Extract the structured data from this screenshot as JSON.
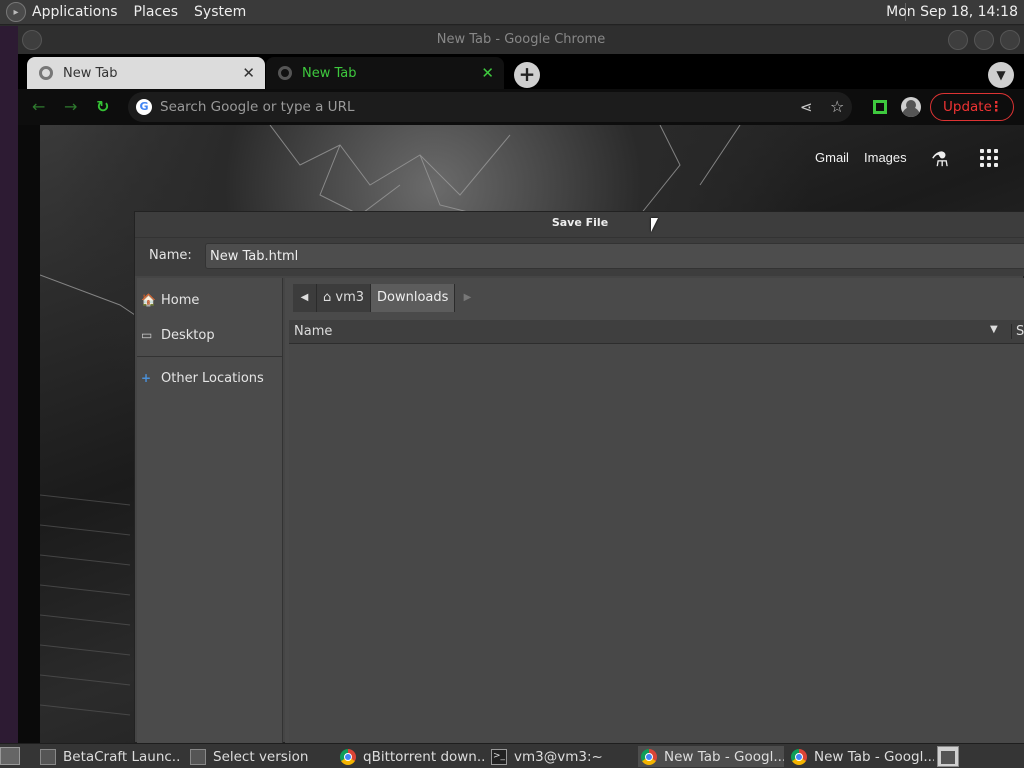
{
  "top_panel": {
    "menus": [
      "Applications",
      "Places",
      "System"
    ],
    "clock": "Mon Sep 18, 14:18"
  },
  "chrome": {
    "window_title": "New Tab - Google Chrome",
    "tabs": [
      {
        "label": "New Tab",
        "close": "✕"
      },
      {
        "label": "New Tab",
        "close": "✕"
      }
    ],
    "new_tab": "+",
    "omnibox_placeholder": "Search Google or type a URL",
    "update_label": "Update",
    "ntp_links": {
      "gmail": "Gmail",
      "images": "Images"
    }
  },
  "dialog": {
    "title": "Save File",
    "name_label": "Name:",
    "filename": "New Tab.html",
    "places": [
      {
        "label": "Home",
        "icon": "home-folder-icon"
      },
      {
        "label": "Desktop",
        "icon": "desktop-folder-icon"
      },
      {
        "label": "Other Locations",
        "icon": "plus-icon"
      }
    ],
    "path": [
      "vm3",
      "Downloads"
    ],
    "columns": {
      "name": "Name",
      "size": "Si"
    }
  },
  "taskbar": {
    "items": [
      {
        "label": "BetaCraft Launc...",
        "icon": "java-icon"
      },
      {
        "label": "Select version",
        "icon": "java-icon"
      },
      {
        "label": "qBittorrent down...",
        "icon": "chrome-icon"
      },
      {
        "label": "vm3@vm3:~",
        "icon": "terminal-icon"
      },
      {
        "label": "New Tab - Googl...",
        "icon": "chrome-icon",
        "active": true
      },
      {
        "label": "New Tab - Googl...",
        "icon": "chrome-icon"
      }
    ]
  },
  "colors": {
    "chrome_accent": "#3ec93e",
    "update_red": "#e33333",
    "dialog_bg": "#454545"
  }
}
